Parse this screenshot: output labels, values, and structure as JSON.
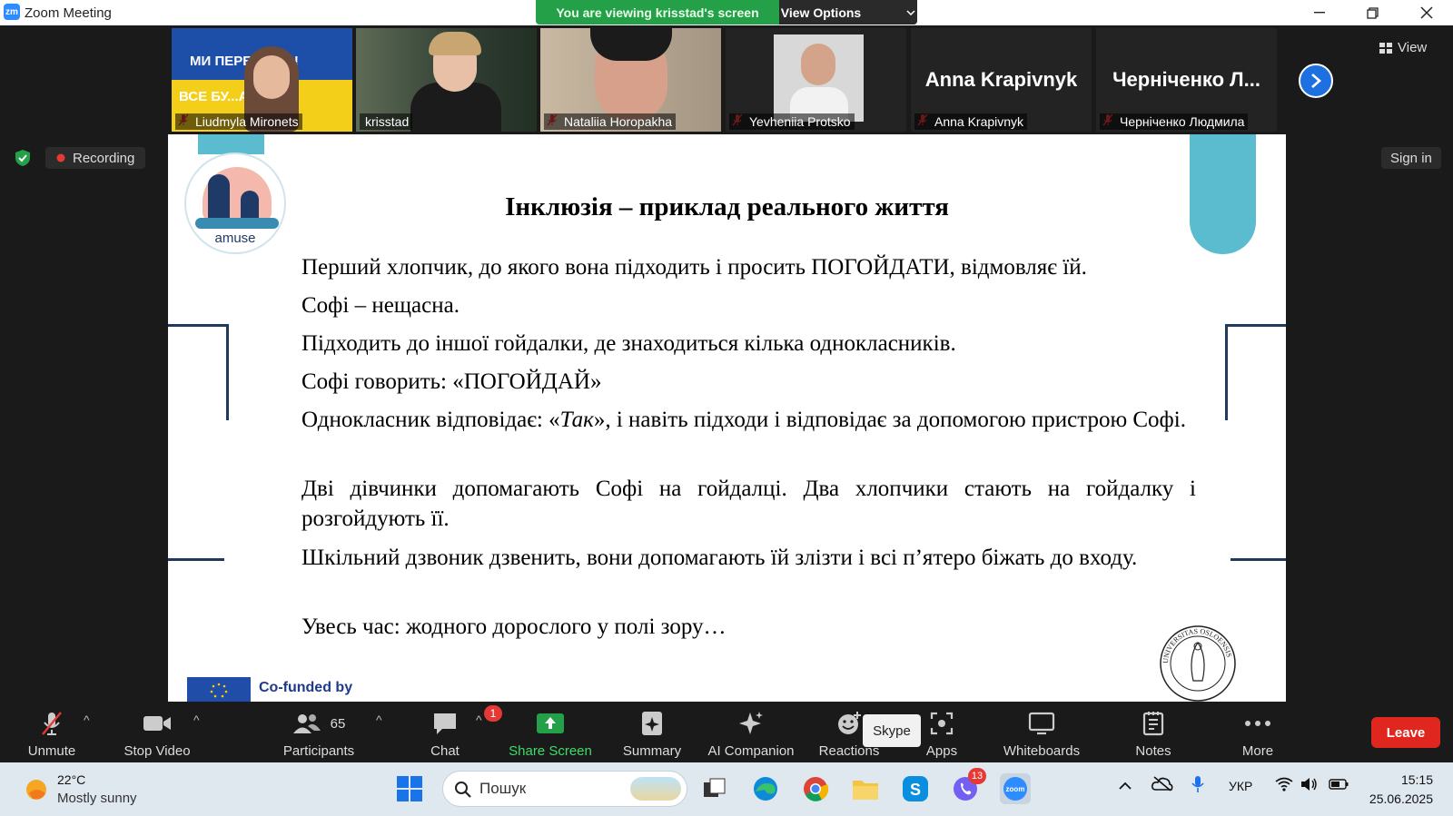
{
  "window": {
    "title": "Zoom Meeting",
    "logo_text": "zm"
  },
  "share_banner": {
    "message": "You are viewing krisstad's screen",
    "view_options": "View Options"
  },
  "participants_strip": [
    {
      "name": "Liudmyla Mironets",
      "muted": true,
      "sign_text_1": "МИ ПЕРЕ...ЕМО!",
      "sign_text_2": "ВСЕ БУ...АЇНА!"
    },
    {
      "name": "krisstad",
      "muted": false
    },
    {
      "name": "Nataliia Horopakha",
      "muted": true
    },
    {
      "name": "Yevheniia Protsko",
      "muted": true
    },
    {
      "name": "Anna Krapivnyk",
      "muted": true,
      "display": "Anna Krapivnyk"
    },
    {
      "name": "Черніченко Людмила",
      "muted": true,
      "display": "Черніченко Л..."
    }
  ],
  "top_controls": {
    "view_label": "View",
    "recording_label": "Recording",
    "sign_in_label": "Sign in"
  },
  "slide": {
    "logo_text": "amuse",
    "heading": "Інклюзія – приклад реального життя",
    "paragraphs": [
      "Перший хлопчик, до якого вона підходить і просить ПОГОЙДАТИ, відмовляє їй.",
      "Софі – нещасна.",
      "Підходить до іншої гойдалки, де знаходиться кілька однокласників.",
      "Софі говорить: «ПОГОЙДАЙ»",
      {
        "before": "Однокласник відповідає: «",
        "em": "Так",
        "after": "», і навіть підходи і відповідає за допомогою пристрою Софі."
      },
      "Дві дівчинки допомагають Софі на гойдалці. Два хлопчики стають на гойдалку і розгойдують її.",
      "Шкільний дзвоник дзвенить, вони допомагають їй злізти і всі п’ятеро біжать до входу.",
      "Увесь час: жодного дорослого у полі зору…"
    ],
    "cofunded": "Co-funded by",
    "seal_text": "UNIVERSITAS OSLOENSIS"
  },
  "toolbar": {
    "unmute": "Unmute",
    "stop_video": "Stop Video",
    "participants": "Participants",
    "participants_count": "65",
    "chat": "Chat",
    "chat_badge": "1",
    "share_screen": "Share Screen",
    "summary": "Summary",
    "ai_companion": "AI Companion",
    "reactions": "Reactions",
    "skype_tooltip": "Skype",
    "apps": "Apps",
    "whiteboards": "Whiteboards",
    "notes": "Notes",
    "more": "More",
    "leave": "Leave"
  },
  "taskbar": {
    "weather_temp": "22°C",
    "weather_desc": "Mostly sunny",
    "search_placeholder": "Пошук",
    "viber_badge": "13",
    "language": "УКР",
    "time": "15:15",
    "date": "25.06.2025"
  },
  "colors": {
    "zoom_blue": "#2d8cff",
    "share_green": "#23a048",
    "leave_red": "#e0271f",
    "slide_accent": "#5bbccf",
    "slide_frame": "#1f3a5a"
  }
}
